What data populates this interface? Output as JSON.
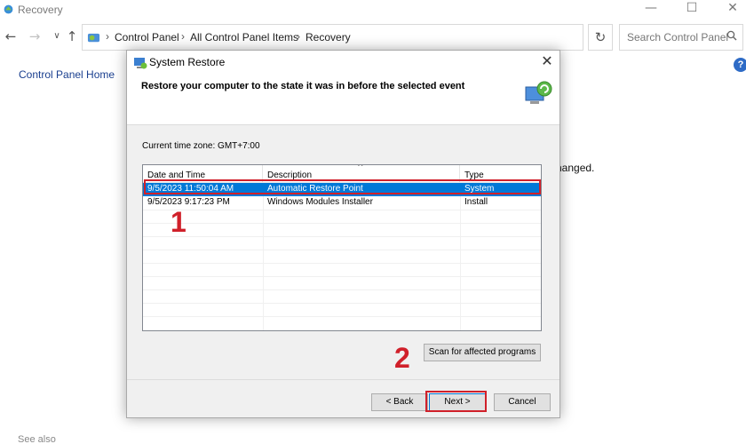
{
  "window": {
    "title": "Recovery",
    "minimize_glyph": "—",
    "maximize_glyph": "☐",
    "close_glyph": "✕"
  },
  "nav": {
    "back_glyph": "←",
    "forward_glyph": "→",
    "recent_glyph": "∨",
    "up_glyph": "↑",
    "refresh_glyph": "↻",
    "breadcrumb": [
      "Control Panel",
      "All Control Panel Items",
      "Recovery"
    ],
    "breadcrumb_sep": "›",
    "search_placeholder": "Search Control Panel"
  },
  "sidebar": {
    "home_link": "Control Panel Home"
  },
  "background": {
    "partial_text": "hanged.",
    "see_also": "See also",
    "help_glyph": "?"
  },
  "dialog": {
    "title": "System Restore",
    "close_glyph": "✕",
    "heading": "Restore your computer to the state it was in before the selected event",
    "timezone": "Current time zone: GMT+7:00",
    "columns": [
      "Date and Time",
      "Description",
      "Type"
    ],
    "sort_glyph": "^",
    "rows": [
      {
        "date": "9/5/2023 11:50:04 AM",
        "description": "Automatic Restore Point",
        "type": "System",
        "selected": true
      },
      {
        "date": "9/5/2023 9:17:23 PM",
        "description": "Windows Modules Installer",
        "type": "Install",
        "selected": false
      }
    ],
    "scan_button": "Scan for affected programs",
    "back_button": "< Back",
    "next_button": "Next >",
    "cancel_button": "Cancel"
  },
  "annotations": {
    "step1": "1",
    "step2": "2",
    "color": "#d0202a"
  },
  "colors": {
    "selection": "#0078d7",
    "link": "#1a3f8f"
  }
}
